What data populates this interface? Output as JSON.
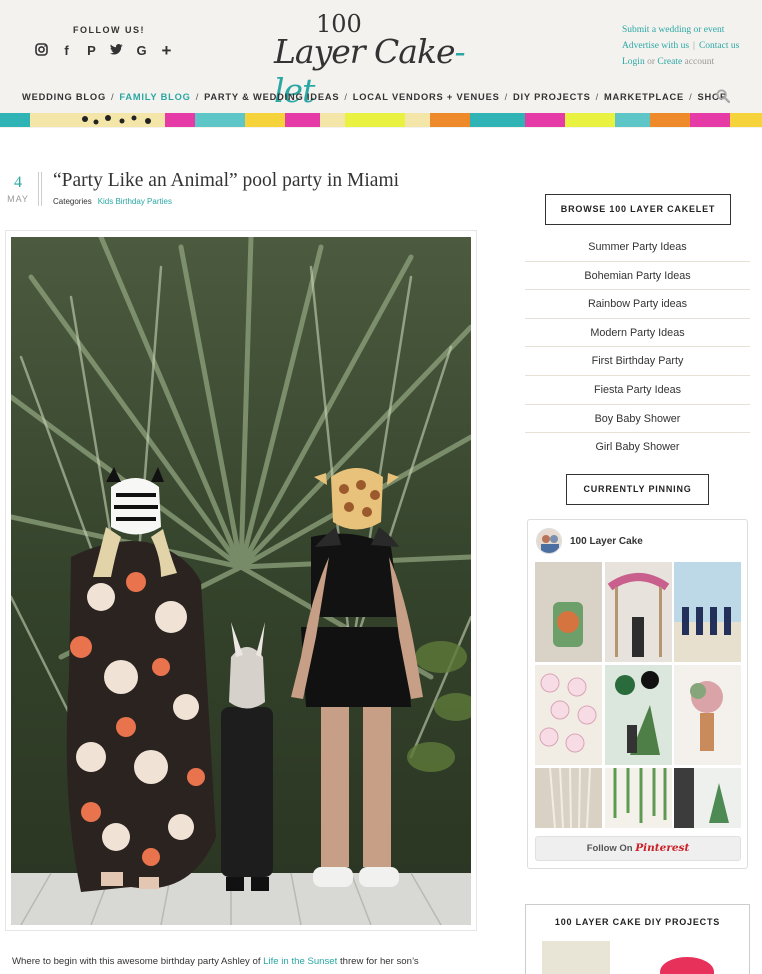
{
  "header": {
    "follow_us": "FOLLOW US!",
    "social_icons": [
      "instagram-icon",
      "facebook-icon",
      "pinterest-icon",
      "twitter-icon",
      "google-plus-icon",
      "bloglovin-plus-icon"
    ],
    "logo_number": "100",
    "logo_main": "Layer Cake",
    "logo_suffix": "-let",
    "submit": "Submit a wedding or event",
    "advertise": "Advertise with us",
    "contact": "Contact us",
    "login": "Login",
    "or": "or",
    "create": "Create",
    "account": "account",
    "brand_color": "#2aa7a3"
  },
  "nav": {
    "items": [
      "WEDDING BLOG",
      "FAMILY BLOG",
      "PARTY & WEDDING IDEAS",
      "LOCAL VENDORS + VENUES",
      "DIY PROJECTS",
      "MARKETPLACE",
      "SHOP"
    ],
    "active": "FAMILY BLOG"
  },
  "post": {
    "day": "4",
    "month": "MAY",
    "title": "“Party Like an Animal” pool party in Miami",
    "categories_label": "Categories",
    "category": "Kids Birthday Parties",
    "intro_before": "Where to begin with this awesome birthday party Ashley of ",
    "intro_link": "Life in the Sunset",
    "intro_after": " threw for her son’s"
  },
  "sidebar": {
    "browse_title": "BROWSE 100 LAYER CAKELET",
    "categories": [
      "Summer Party Ideas",
      "Bohemian Party Ideas",
      "Rainbow Party ideas",
      "Modern Party Ideas",
      "First Birthday Party",
      "Fiesta Party Ideas",
      "Boy Baby Shower",
      "Girl Baby Shower"
    ],
    "pinning_title": "CURRENTLY PINNING",
    "pin_account": "100 Layer Cake",
    "follow_on": "Follow On",
    "pinterest": "Pinterest",
    "diy_title": "100 LAYER CAKE DIY PROJECTS"
  }
}
